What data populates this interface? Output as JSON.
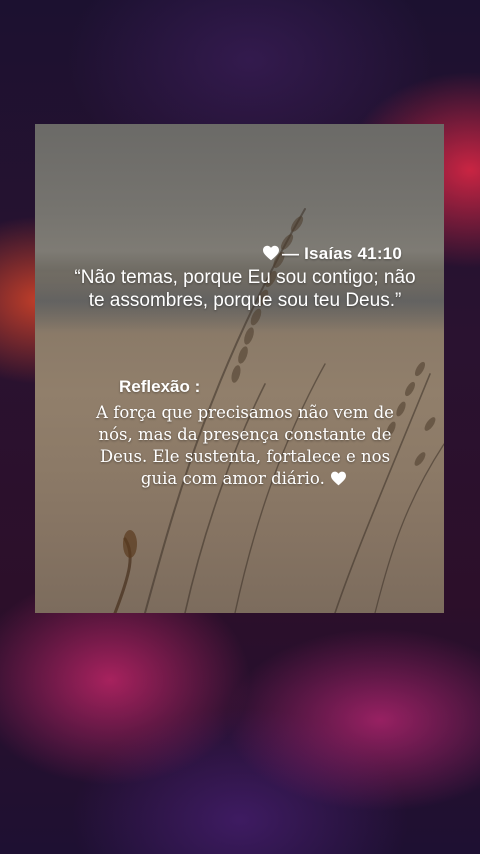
{
  "verse": {
    "reference": "— Isaías 41:10",
    "text": "“Não temas, porque Eu sou contigo; não te assombres, porque sou teu Deus.”"
  },
  "reflection": {
    "title": "Reflexão :",
    "body": "A força que precisamos não vem de nós, mas da presença constante de Deus. Ele sustenta, fortalece e nos guia com amor diário."
  },
  "icons": {
    "verse_icon": "heart-icon",
    "reflection_icon": "heart-icon"
  },
  "colors": {
    "text": "#ffffff",
    "background_accent_red": "#e0462a",
    "background_accent_magenta": "#d2286e",
    "background_base": "#1c1130"
  }
}
